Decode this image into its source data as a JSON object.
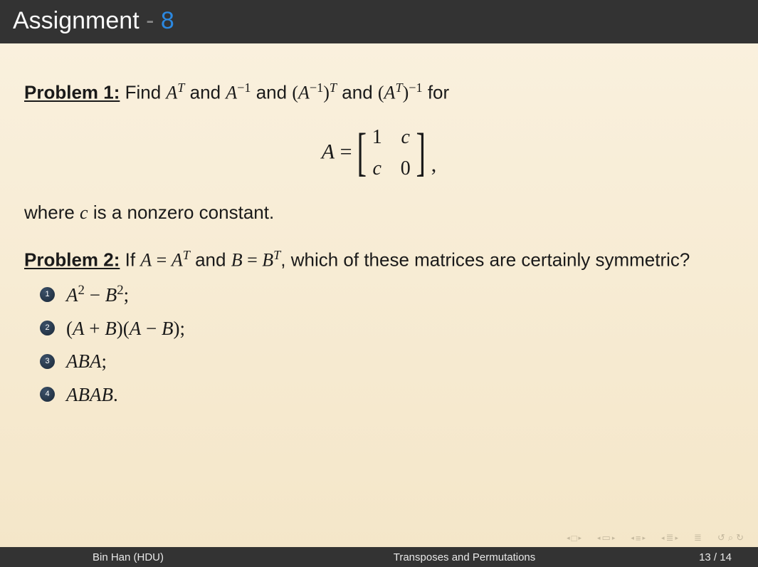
{
  "header": {
    "title_main": "Assignment",
    "title_sep": " - ",
    "title_num": "8"
  },
  "problem1": {
    "label": "Problem 1:",
    "text_before": " Find ",
    "expr1_base": "A",
    "expr1_sup": "T",
    "and1": " and ",
    "expr2_base": "A",
    "expr2_sup": "−1",
    "and2": " and ",
    "expr3_open": "(",
    "expr3_base": "A",
    "expr3_sup1": "−1",
    "expr3_close": ")",
    "expr3_sup2": "T",
    "and3": " and ",
    "expr4_open": "(",
    "expr4_base": "A",
    "expr4_sup1": "T",
    "expr4_close": ")",
    "expr4_sup2": "−1",
    "for_text": " for",
    "eq_lhs": "A",
    "eq_eq": " = ",
    "matrix": {
      "r1c1": "1",
      "r1c2": "c",
      "r2c1": "c",
      "r2c2": "0"
    },
    "eq_comma": ",",
    "where_pre": "where ",
    "where_var": "c",
    "where_post": " is a nonzero constant."
  },
  "problem2": {
    "label": "Problem 2:",
    "text_pre": " If ",
    "a": "A",
    "eq1": " = ",
    "at_base": "A",
    "at_sup": "T",
    "and": " and ",
    "b": "B",
    "eq2": " = ",
    "bt_base": "B",
    "bt_sup": "T",
    "text_post": ", which of these matrices are certainly symmetric?",
    "items": [
      {
        "num": "1",
        "html": "A² − B²;",
        "a": "A",
        "sup1": "2",
        "minus": " − ",
        "b": "B",
        "sup2": "2",
        "semi": ";"
      },
      {
        "num": "2",
        "open": "(",
        "a": "A",
        "plus": " + ",
        "b": "B",
        "close": ")(",
        "a2": "A",
        "minus": " − ",
        "b2": "B",
        "close2": ");"
      },
      {
        "num": "3",
        "text": "ABA",
        "semi": ";"
      },
      {
        "num": "4",
        "text": "ABAB",
        "dot": "."
      }
    ]
  },
  "nav": {
    "back_slide": "◂ □ ▸",
    "back_sub": "◂ ▭ ▸",
    "lines1": "◂ ≡ ▸",
    "lines2": "◂ ≣ ▸",
    "goto": "≣",
    "undo": "↺",
    "search": "⌕",
    "redo": "↻"
  },
  "footer": {
    "author": "Bin Han (HDU)",
    "title": "Transposes and Permutations",
    "page": "13 / 14"
  }
}
